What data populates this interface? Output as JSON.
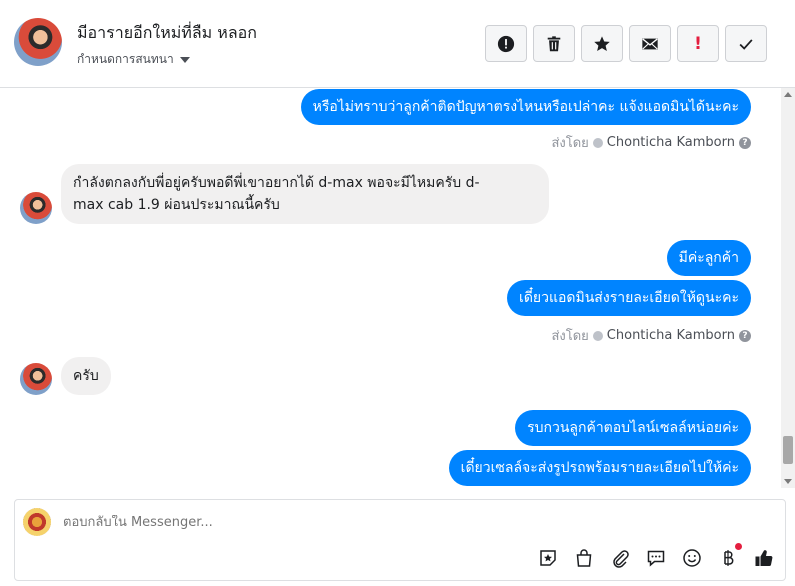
{
  "header": {
    "title": "มีอารายอีกใหม่ที่ลืม หลอก",
    "subtitle": "กำหนดการสนทนา",
    "buttons": [
      "spam-icon",
      "trash-icon",
      "star-icon",
      "mail-icon",
      "mark-important",
      "done-icon"
    ],
    "important_label": "!"
  },
  "messages": {
    "m1": "หรือไม่ทราบว่าลูกค้าติดปัญหาตรงไหนหรือเปล่าคะ แจ้งแอดมินได้นะคะ",
    "sent1_prefix": "ส่งโดย",
    "sent1_name": "Chonticha Kamborn",
    "m2_line1": "กำลังตกลงกับพี่อยู่ครับพอดีพี่เขาอยากได้ d-max พอจะมีไหมครับ d-",
    "m2_line2": "max cab 1.9 ผ่อนประมาณนี้ครับ",
    "m3": "มีค่ะลูกค้า",
    "m4": "เดี๋ยวแอดมินส่งรายละเอียดให้ดูนะคะ",
    "sent2_prefix": "ส่งโดย",
    "sent2_name": "Chonticha Kamborn",
    "m5": "ครับ",
    "m6": "รบกวนลูกค้าตอบไลน์เซลล์หน่อยค่ะ",
    "m7": "เดี๋ยวเซลล์จะส่งรูปรถพร้อมรายละเอียดไปให้ค่ะ"
  },
  "composer": {
    "placeholder": "ตอบกลับใน Messenger...",
    "tools": [
      "sticker-icon",
      "shop-icon",
      "attach-icon",
      "saved-replies-icon",
      "emoji-icon",
      "baht-icon",
      "like-icon"
    ]
  },
  "colors": {
    "accent": "#0084ff",
    "incoming": "#f1f0f0",
    "danger": "#e41e3f"
  }
}
